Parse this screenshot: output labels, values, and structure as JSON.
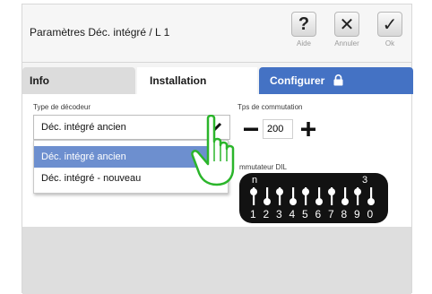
{
  "header": {
    "title": "Paramètres Déc. intégré / L 1",
    "buttons": [
      {
        "icon": "?",
        "label": "Aide"
      },
      {
        "icon": "✕",
        "label": "Annuler"
      },
      {
        "icon": "✓",
        "label": "Ok"
      }
    ]
  },
  "tabs": {
    "info": "Info",
    "installation": "Installation",
    "configurer": "Configurer"
  },
  "form": {
    "decoder_label": "Type de décodeur",
    "decoder_value": "Déc. intégré ancien",
    "options": [
      "Déc. intégré ancien",
      "Déc. intégré - nouveau"
    ],
    "commutation_label": "Tps de commutation",
    "commutation_value": "200",
    "minus": "—",
    "plus": "+",
    "dil_label": "mmutateur DIL",
    "dil_on": "n",
    "dil_mark": "3",
    "dil_numbers": [
      "1",
      "2",
      "3",
      "4",
      "5",
      "6",
      "7",
      "8",
      "9",
      "0"
    ],
    "dil_up": [
      true,
      false,
      true,
      false,
      true,
      false,
      true,
      false,
      true,
      false
    ]
  },
  "colors": {
    "accent": "#4472c4",
    "selected_option": "#6d8fcf",
    "hand_fill": "#ffffff",
    "hand_outline": "#2bb52b"
  }
}
